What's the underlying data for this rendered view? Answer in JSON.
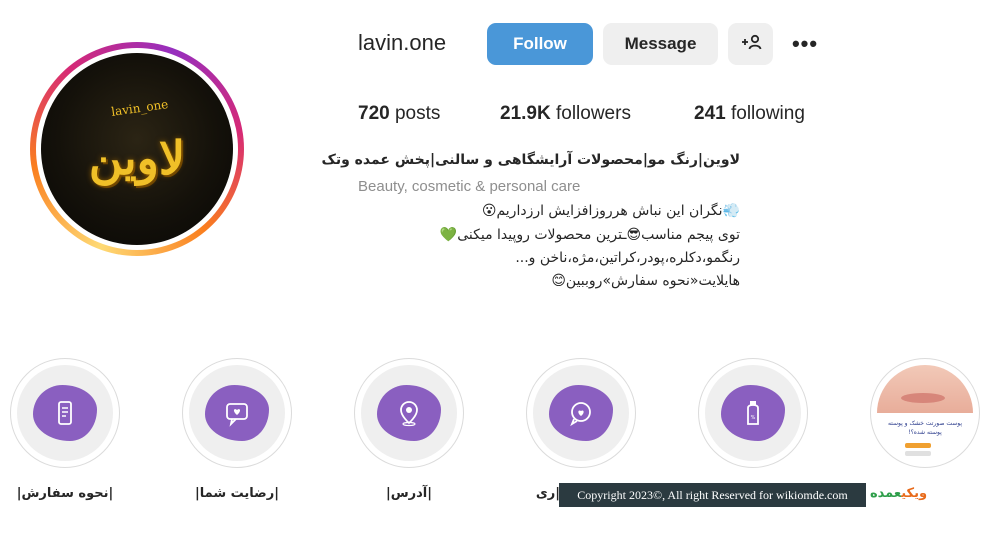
{
  "profile": {
    "username": "lavin.one",
    "avatar_text": "لاوین",
    "avatar_handle": "lavin_one"
  },
  "actions": {
    "follow": "Follow",
    "message": "Message",
    "add_user_icon": "+👤",
    "more_icon": "•••"
  },
  "stats": {
    "posts_count": "720",
    "posts_label": "posts",
    "followers_count": "21.9K",
    "followers_label": "followers",
    "following_count": "241",
    "following_label": "following"
  },
  "bio": {
    "line1": "لاوین|رنگ مو|محصولات آرایشگاهی و سالنی|پخش عمده وتک",
    "category": "Beauty, cosmetic & personal care",
    "line2": "💨نگران این نباش هرروزافزایش ارزداریم😮",
    "line3": "توی پیجم مناسب😎ـترین محصولات روپیدا میکنی💚",
    "line4": "رنگمو،دکلره،پودر،کراتین،مژه،ناخن و...",
    "line5": "هایلایت«نحوه سفارش»روببین😊"
  },
  "highlights": [
    {
      "label": "|نحوه سفارش|",
      "icon": "phone-order-icon"
    },
    {
      "label": "|رضایت شما|",
      "icon": "chat-heart-icon"
    },
    {
      "label": "|آدرس|",
      "icon": "location-pin-icon"
    },
    {
      "label": "|ری",
      "icon": "heart-bubble-icon"
    },
    {
      "label": "",
      "icon": "bottle-icon"
    },
    {
      "label": "",
      "icon": "photo-thumbnail",
      "photo_text": "پوست صورتت خشک و پوسته پوسته شده؟!"
    }
  ],
  "watermark": {
    "copyright": "Copyright 2023©, All right Reserved for wikiomde.com",
    "logo_part1": "ویکی",
    "logo_part2": "عمده"
  },
  "colors": {
    "follow_button": "#4a97d8",
    "highlight_blob": "#8a5fc0",
    "avatar_gold": "#f0c028"
  }
}
